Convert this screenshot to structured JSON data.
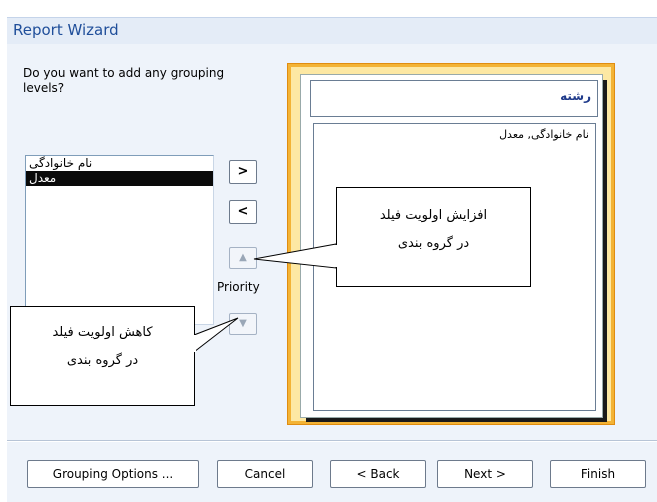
{
  "window": {
    "title": "Report Wizard"
  },
  "question": "Do you want to add any grouping levels?",
  "field_list": {
    "items": [
      {
        "label": "نام خانوادگی",
        "selected": false
      },
      {
        "label": "معدل",
        "selected": true
      }
    ]
  },
  "buttons": {
    "add": ">",
    "remove": "<",
    "priority_up": "▲",
    "priority_down": "▼",
    "priority_label": "Priority",
    "grouping_options": "Grouping Options ...",
    "cancel": "Cancel",
    "back": "< Back",
    "next": "Next >",
    "finish": "Finish"
  },
  "preview": {
    "group_header": "رشته",
    "detail_fields": "نام خانوادگی, معدل"
  },
  "callouts": {
    "increase": {
      "line1": "افزایش اولویت فیلد",
      "line2": "در گروه بندی"
    },
    "decrease": {
      "line1": "کاهش اولویت فیلد",
      "line2": "در گروه بندی"
    }
  },
  "colors": {
    "title": "#1f4e9a",
    "accent": "#f3b335",
    "selection": "#0a0a0a"
  }
}
